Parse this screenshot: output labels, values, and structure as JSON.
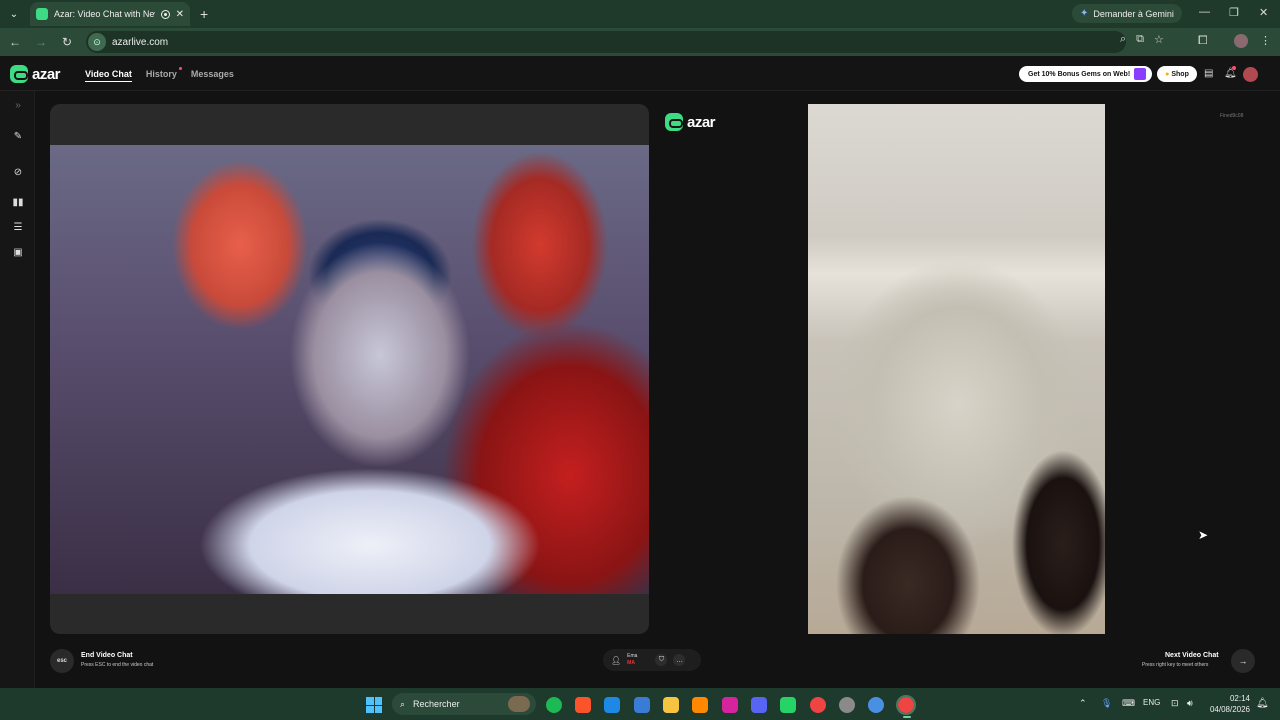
{
  "browser": {
    "tab_title": "Azar: Video Chat with New",
    "url": "azarlive.com",
    "gemini_label": "Demander à Gemini"
  },
  "app": {
    "logo_text": "azar",
    "nav": [
      {
        "label": "Video Chat",
        "active": true
      },
      {
        "label": "History",
        "active": false,
        "dot": true
      },
      {
        "label": "Messages",
        "active": false
      }
    ],
    "gems_promo": "Get 10% Bonus Gems on Web!",
    "shop_label": "Shop"
  },
  "chat": {
    "remote_id": "Fined9c08",
    "end": {
      "key": "esc",
      "title": "End Video Chat",
      "hint": "Press ESC to end the video chat"
    },
    "partner": {
      "name": "Ema",
      "country": "MA"
    },
    "next": {
      "title": "Next Video Chat",
      "hint": "Press right key to meet others"
    }
  },
  "taskbar": {
    "search_placeholder": "Rechercher",
    "language": "ENG",
    "time": "02:14",
    "date": "04/08/2026"
  },
  "colors": {
    "brand": "#3ddc84",
    "chrome": "#2c4a38",
    "background": "#121212"
  }
}
